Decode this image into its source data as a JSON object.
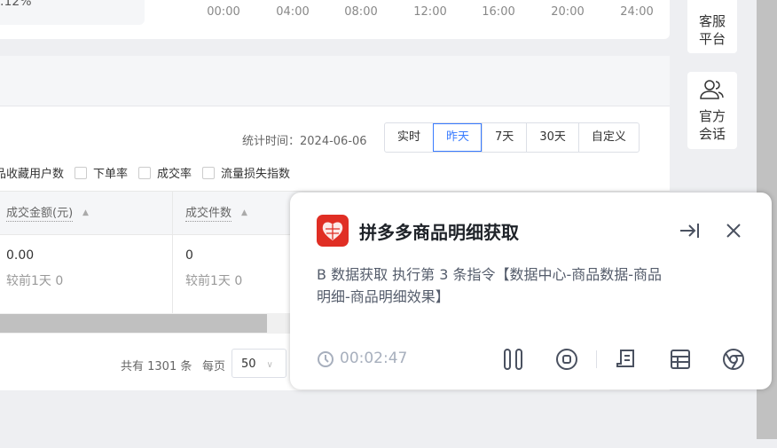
{
  "top_stat": {
    "percent": ".12%"
  },
  "chart_ticks": [
    "00:00",
    "04:00",
    "08:00",
    "12:00",
    "16:00",
    "20:00",
    "24:00"
  ],
  "filter": {
    "stat_time_label": "统计时间：2024-06-06",
    "ranges": [
      "实时",
      "昨天",
      "7天",
      "30天",
      "自定义"
    ],
    "active_range": "昨天"
  },
  "metrics": [
    {
      "label": "品收藏用户数",
      "checked": false
    },
    {
      "label": "下单率",
      "checked": false
    },
    {
      "label": "成交率",
      "checked": false
    },
    {
      "label": "流量损失指数",
      "checked": false
    }
  ],
  "table": {
    "columns": [
      "成交金额(元)",
      "成交件数"
    ],
    "row": {
      "values": [
        "0.00",
        "0"
      ],
      "compare": [
        "较前1天 0",
        "较前1天 0"
      ]
    },
    "scroll_fraction": 0.4
  },
  "pagination": {
    "total": "共有 1301 条",
    "per_page_label": "每页",
    "per_page": "50"
  },
  "side": {
    "service": "客服\n平台",
    "service_l1": "客服",
    "service_l2": "平台",
    "chat_l1": "官方",
    "chat_l2": "会话"
  },
  "popup": {
    "title": "拼多多商品明细获取",
    "message": "B 数据获取 执行第 3 条指令【数据中心-商品数据-商品明细-商品明细效果】",
    "elapsed": "00:02:47",
    "brand_color": "#e02e24"
  }
}
